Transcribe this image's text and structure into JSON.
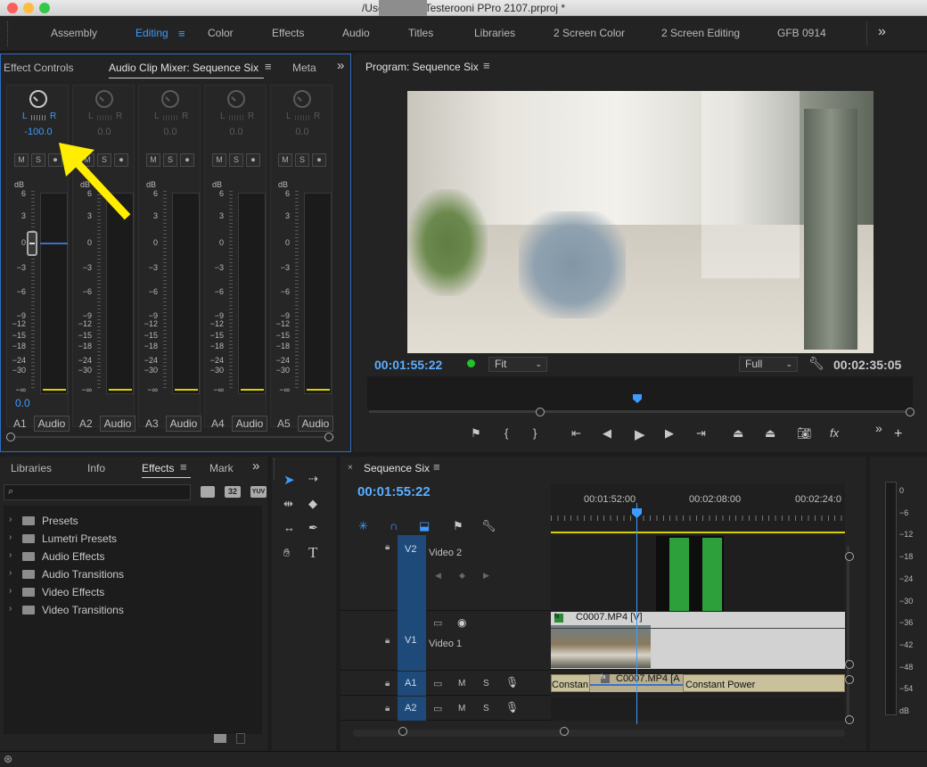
{
  "window": {
    "title": "/User          esktop/Testerooni PPro 2107.prproj *"
  },
  "workspaces": [
    "Assembly",
    "Editing",
    "Color",
    "Effects",
    "Audio",
    "Titles",
    "Libraries",
    "2 Screen Color",
    "2 Screen Editing",
    "GFB 0914"
  ],
  "active_workspace": "Editing",
  "left_top_panel": {
    "tabs": [
      "Effect Controls",
      "Audio Clip Mixer: Sequence Six",
      "Meta"
    ],
    "channels": [
      {
        "pan_value": "-100.0",
        "label": "A1",
        "name": "Audio"
      },
      {
        "pan_value": "0.0",
        "label": "A2",
        "name": "Audio"
      },
      {
        "pan_value": "0.0",
        "label": "A3",
        "name": "Audio"
      },
      {
        "pan_value": "0.0",
        "label": "A4",
        "name": "Audio"
      },
      {
        "pan_value": "0.0",
        "label": "A5",
        "name": "Audio"
      }
    ],
    "lr_label_l": "L",
    "lr_label_r": "R",
    "msr_buttons": [
      "M",
      "S",
      "⏺"
    ],
    "db_label": "dB",
    "scale_marks": [
      "6",
      "3",
      "0",
      "−3",
      "−6",
      "−9",
      "−12",
      "−15",
      "−18",
      "−24",
      "−30",
      "−∞"
    ],
    "fader_value": "0.0",
    "fader_value_numeric": 0.0
  },
  "program_monitor": {
    "title": "Program: Sequence Six",
    "timecode": "00:01:55:22",
    "fit_select": "Fit",
    "quality_select": "Full",
    "duration": "00:02:35:05"
  },
  "bottom_left_panel": {
    "tabs": [
      "Libraries",
      "Info",
      "Effects",
      "Mark"
    ],
    "search_placeholder": "",
    "badges": [
      "32",
      "YUV"
    ],
    "folders": [
      "Presets",
      "Lumetri Presets",
      "Audio Effects",
      "Audio Transitions",
      "Video Effects",
      "Video Transitions"
    ]
  },
  "timeline": {
    "sequence_name": "Sequence Six",
    "timecode": "00:01:55:22",
    "ruler": [
      "00:01:52:00",
      "00:02:08:00",
      "00:02:24:0"
    ],
    "tracks": [
      {
        "id": "V2",
        "name": "Video 2"
      },
      {
        "id": "V1",
        "name": "Video 1"
      },
      {
        "id": "A1",
        "name": ""
      },
      {
        "id": "A2",
        "name": ""
      }
    ],
    "video_clip": "C0007.MP4 [V]",
    "audio_clip": "C0007.MP4 [A",
    "transition_left": "Constan",
    "transition_right": "Constant Power",
    "track_buttons": [
      "M",
      "S"
    ]
  },
  "audio_meter": {
    "scale": [
      "0",
      "−6",
      "−12",
      "−18",
      "−24",
      "−30",
      "−36",
      "−42",
      "−48",
      "−54",
      "dB"
    ]
  }
}
